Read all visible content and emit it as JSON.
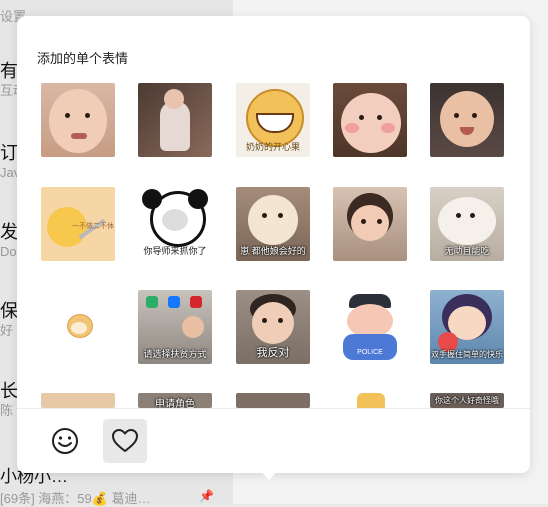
{
  "background_list": {
    "top_label": "设置",
    "items": [
      {
        "title": "有",
        "sub": "互动"
      },
      {
        "title": "订",
        "sub": "Jav"
      },
      {
        "title": "发",
        "sub": "Do"
      },
      {
        "title": "保",
        "sub": "好"
      },
      {
        "title": "长",
        "sub": "陈"
      }
    ],
    "bottom_title": "小杨小…",
    "bottom_sub": "[69条] 海燕：59💰 葛迪…"
  },
  "sticker_panel": {
    "section_title": "添加的单个表情",
    "stickers": [
      {
        "name": "crying-baby",
        "caption": ""
      },
      {
        "name": "girl-in-chair",
        "caption": ""
      },
      {
        "name": "smiling-cookie",
        "caption": "奶奶的开心果"
      },
      {
        "name": "chubby-baby",
        "caption": ""
      },
      {
        "name": "smiling-toddler",
        "caption": ""
      },
      {
        "name": "duck-with-knife",
        "caption": "一不做二不休"
      },
      {
        "name": "panda-face",
        "caption": "你导师来抓你了"
      },
      {
        "name": "shiba-dog",
        "caption": "崽 都他娘会好的"
      },
      {
        "name": "girl-leaning",
        "caption": ""
      },
      {
        "name": "fluffy-dog",
        "caption": "无助且能吃"
      },
      {
        "name": "doge-small",
        "caption": ""
      },
      {
        "name": "payment-kid",
        "caption": "请选择扶贫方式"
      },
      {
        "name": "boy-refuse",
        "caption": "我反对"
      },
      {
        "name": "police-cartoon",
        "caption": "POLICE"
      },
      {
        "name": "anime-girl-money",
        "caption": "双手握住简单的快乐"
      },
      {
        "name": "partial-sticker-1",
        "caption": "申请角色"
      },
      {
        "name": "partial-sticker-2",
        "caption": ""
      },
      {
        "name": "partial-sticker-3",
        "caption": ""
      },
      {
        "name": "partial-sticker-4",
        "caption": ""
      },
      {
        "name": "partial-sticker-5",
        "caption": "你这个人好奇怪哦"
      }
    ]
  },
  "footer": {
    "tabs": [
      {
        "name": "emoji-tab",
        "icon": "smiley-icon",
        "active": false
      },
      {
        "name": "favorites-tab",
        "icon": "heart-icon",
        "active": true
      }
    ]
  },
  "colors": {
    "popup_bg": "#ffffff",
    "active_tab_bg": "#e8e8e8",
    "list_bg": "#e6e6e6"
  }
}
